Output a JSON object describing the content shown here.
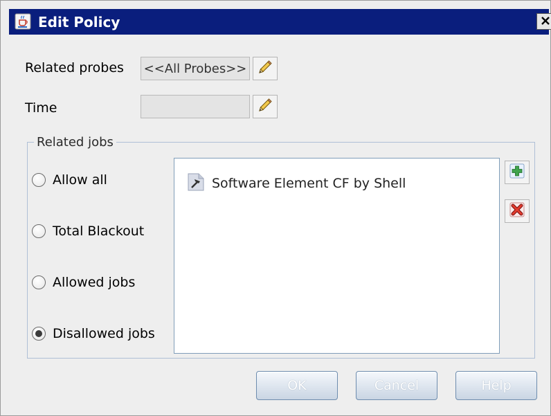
{
  "window": {
    "title": "Edit Policy",
    "title_icon": "java-cup-icon",
    "close_icon": "close-icon"
  },
  "form": {
    "related_probes_label": "Related probes",
    "related_probes_value": "<<All Probes>>",
    "time_label": "Time",
    "time_value": "",
    "edit_icon": "pencil-icon"
  },
  "related_jobs": {
    "group_title": "Related jobs",
    "options": [
      {
        "label": "Allow all",
        "selected": false
      },
      {
        "label": "Total Blackout",
        "selected": false
      },
      {
        "label": "Allowed jobs",
        "selected": false
      },
      {
        "label": "Disallowed jobs",
        "selected": true
      }
    ],
    "jobs": [
      {
        "label": "Software Element CF by Shell",
        "icon": "job-hammer-icon"
      }
    ],
    "add_icon": "plus-icon",
    "remove_icon": "red-x-icon"
  },
  "buttons": {
    "ok": "OK",
    "cancel": "Cancel",
    "help": "Help"
  },
  "colors": {
    "titlebar": "#0a1e7d",
    "dialog_bg": "#eeeeee",
    "list_border": "#7f9db9",
    "button_text": "#ffffff"
  }
}
